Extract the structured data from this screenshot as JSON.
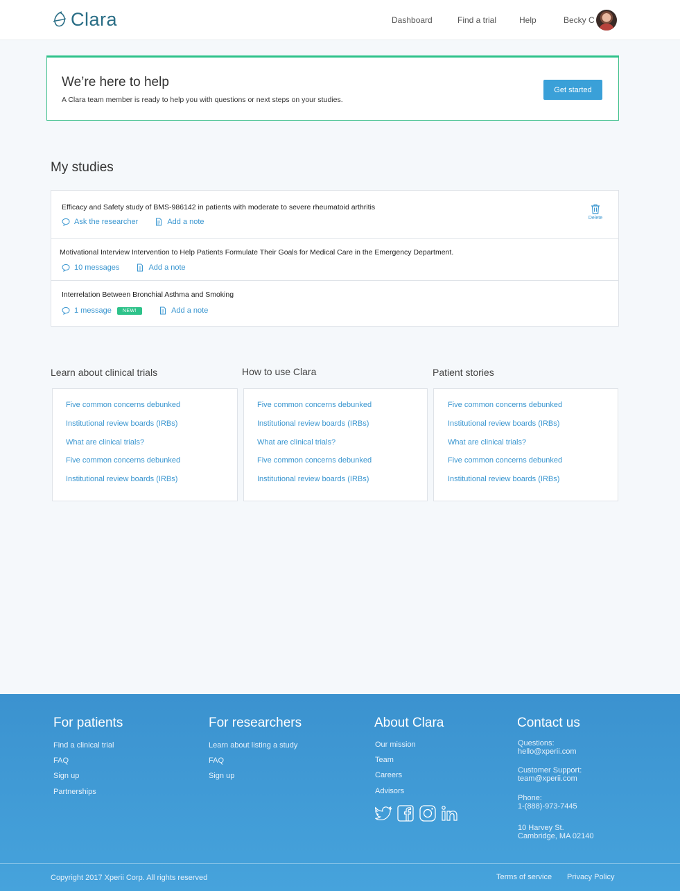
{
  "header": {
    "logo_text": "Clara",
    "nav": [
      "Dashboard",
      "Find a trial",
      "Help"
    ],
    "user_name": "Becky C"
  },
  "help_box": {
    "title": "We’re here to help",
    "description": "A Clara team member is ready to help you with questions or next steps on your studies.",
    "button_label": "Get started"
  },
  "studies": {
    "title": "My studies",
    "delete_label": "Delete",
    "items": [
      {
        "title": "Efficacy and Safety study of BMS-986142 in patients with moderate to severe rheumatoid arthritis",
        "message_label": "Ask the researcher",
        "note_label": "Add a note"
      },
      {
        "title": "Motivational Interview Intervention to Help Patients Formulate Their Goals for Medical Care in the Emergency Department.",
        "message_label": "10 messages",
        "note_label": "Add a note"
      },
      {
        "title": "Interrelation Between Bronchial Asthma and Smoking",
        "message_label": "1 message",
        "badge": "NEW!",
        "note_label": "Add a note"
      }
    ]
  },
  "resources": [
    {
      "title": "Learn about clinical trials",
      "links": [
        "Five common concerns debunked",
        "Institutional review boards (IRBs)",
        "What are clinical trials?",
        "Five common concerns debunked",
        "Institutional review boards (IRBs)"
      ]
    },
    {
      "title": "How to use Clara",
      "links": [
        "Five common concerns debunked",
        "Institutional review boards (IRBs)",
        "What are clinical trials?",
        "Five common concerns debunked",
        "Institutional review boards (IRBs)"
      ]
    },
    {
      "title": "Patient stories",
      "links": [
        "Five common concerns debunked",
        "Institutional review boards (IRBs)",
        "What are clinical trials?",
        "Five common concerns debunked",
        "Institutional review boards (IRBs)"
      ]
    }
  ],
  "footer": {
    "patients": {
      "title": "For patients",
      "links": [
        "Find a clinical trial",
        "FAQ",
        "Sign up",
        "Partnerships"
      ]
    },
    "researchers": {
      "title": "For researchers",
      "links": [
        "Learn about listing a study",
        "FAQ",
        "Sign up"
      ]
    },
    "about": {
      "title": "About Clara",
      "links": [
        "Our mission",
        "Team",
        "Careers",
        "Advisors"
      ]
    },
    "contact": {
      "title": "Contact us",
      "items": [
        {
          "label": "Questions:",
          "value": "hello@xperii.com"
        },
        {
          "label": "Customer Support:",
          "value": "team@xperii.com"
        },
        {
          "label": "Phone:",
          "value": "1-(888)-973-7445"
        },
        {
          "label": "10 Harvey St.",
          "value": "Cambridge, MA 02140"
        }
      ]
    },
    "social_icons": [
      "twitter-icon",
      "facebook-icon",
      "instagram-icon",
      "linkedin-icon"
    ],
    "copyright": "Copyright 2017 Xperii Corp. All rights reserved",
    "legal": [
      "Terms of service",
      "Privacy Policy"
    ]
  },
  "colors": {
    "accent": "#3aa0d8",
    "success": "#2ec28a",
    "footer": "#3b92cf"
  }
}
